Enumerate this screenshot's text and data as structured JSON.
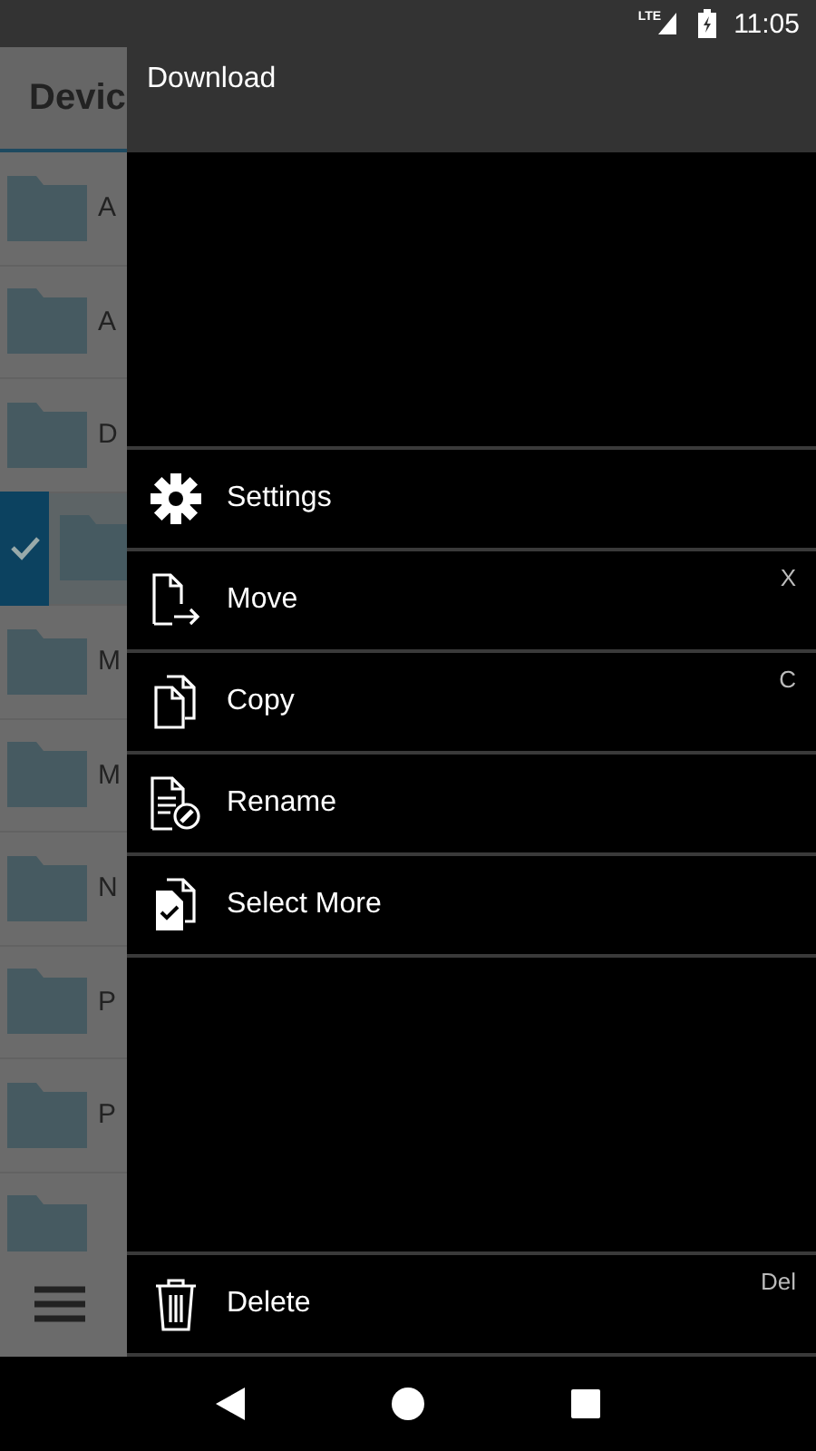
{
  "status_bar": {
    "time": "11:05",
    "network": "LTE"
  },
  "background_app": {
    "title": "Devic",
    "rows": [
      {
        "letter": "A",
        "selected": false
      },
      {
        "letter": "A",
        "selected": false
      },
      {
        "letter": "D",
        "selected": false
      },
      {
        "selected": true
      },
      {
        "letter": "M",
        "selected": false
      },
      {
        "letter": "M",
        "selected": false
      },
      {
        "letter": "N",
        "selected": false
      },
      {
        "letter": "P",
        "selected": false
      },
      {
        "letter": "P",
        "selected": false
      },
      {
        "selected": false
      }
    ]
  },
  "drawer": {
    "title": "Download",
    "items": [
      {
        "kind": "settings",
        "label": "Settings"
      },
      {
        "kind": "move",
        "label": "Move",
        "shortcut": "X"
      },
      {
        "kind": "copy",
        "label": "Copy",
        "shortcut": "C"
      },
      {
        "kind": "rename",
        "label": "Rename"
      },
      {
        "kind": "select",
        "label": "Select More"
      }
    ],
    "bottom_item": {
      "kind": "delete",
      "label": "Delete",
      "shortcut": "Del"
    }
  }
}
